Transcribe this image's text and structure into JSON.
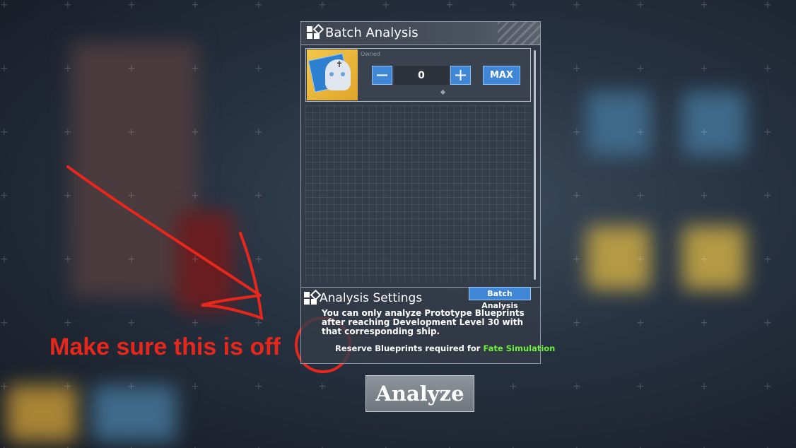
{
  "dialog": {
    "title": "Batch Analysis",
    "item": {
      "count_label": "Owned",
      "quantity": "0",
      "minus_label": "−",
      "plus_label": "+",
      "max_label": "MAX"
    }
  },
  "settings": {
    "title": "Analysis Settings",
    "batch_button_label": "Batch Analysis",
    "note": "You can only analyze Prototype Blueprints after reaching Development Level 30 with that corresponding ship.",
    "reserve_prefix": "Reserve Blueprints required for",
    "reserve_highlight": "Fate Simulation",
    "reserve_enabled": false
  },
  "analyze_button_label": "Analyze",
  "annotation": {
    "text": "Make sure this is off"
  },
  "colors": {
    "accent_blue": "#3f87d6",
    "highlight_green": "#6cf03a",
    "annotation_red": "#e8271c"
  }
}
